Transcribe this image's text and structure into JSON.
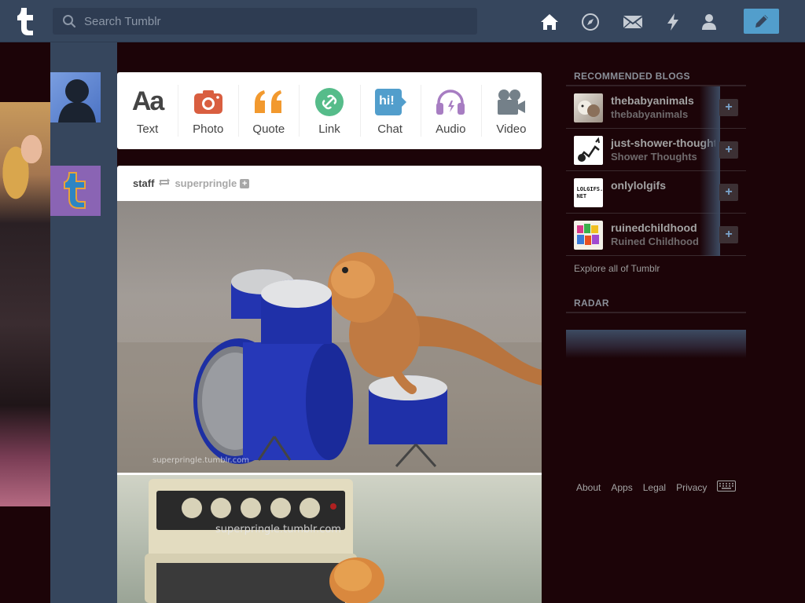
{
  "search": {
    "placeholder": "Search Tumblr"
  },
  "nav": {
    "icons": [
      "home-icon",
      "explore-icon",
      "inbox-icon",
      "activity-icon",
      "account-icon"
    ],
    "compose_icon": "pencil-icon"
  },
  "post_types": [
    {
      "label": "Text",
      "icon": "Aa",
      "color": "#444444"
    },
    {
      "label": "Photo",
      "icon": "camera-icon",
      "color": "#d95e40"
    },
    {
      "label": "Quote",
      "icon": "quote-icon",
      "color": "#f2992e"
    },
    {
      "label": "Link",
      "icon": "link-icon",
      "color": "#56bc8a"
    },
    {
      "label": "Chat",
      "icon": "hi!",
      "color": "#529ecc"
    },
    {
      "label": "Audio",
      "icon": "headphones-icon",
      "color": "#a77dc2"
    },
    {
      "label": "Video",
      "icon": "video-camera-icon",
      "color": "#748089"
    }
  ],
  "post": {
    "author": "staff",
    "source": "superpringle",
    "follow_label": "+",
    "watermark_1": "superpringle.tumblr.com",
    "watermark_2": "superpringle.tumblr.com"
  },
  "sidebar": {
    "recommended_title": "RECOMMENDED BLOGS",
    "blogs": [
      {
        "name": "thebabyanimals",
        "subtitle": "thebabyanimals"
      },
      {
        "name": "just-shower-thoughts",
        "subtitle": "Shower Thoughts"
      },
      {
        "name": "onlylolgifs",
        "subtitle": "",
        "avatar_text": "LOLGIFS. NET"
      },
      {
        "name": "ruinedchildhood",
        "subtitle": "Ruined Childhood"
      }
    ],
    "follow_label": "+",
    "explore_label": "Explore all of Tumblr",
    "radar_title": "RADAR"
  },
  "footer": {
    "links": [
      "About",
      "Apps",
      "Legal",
      "Privacy"
    ]
  }
}
